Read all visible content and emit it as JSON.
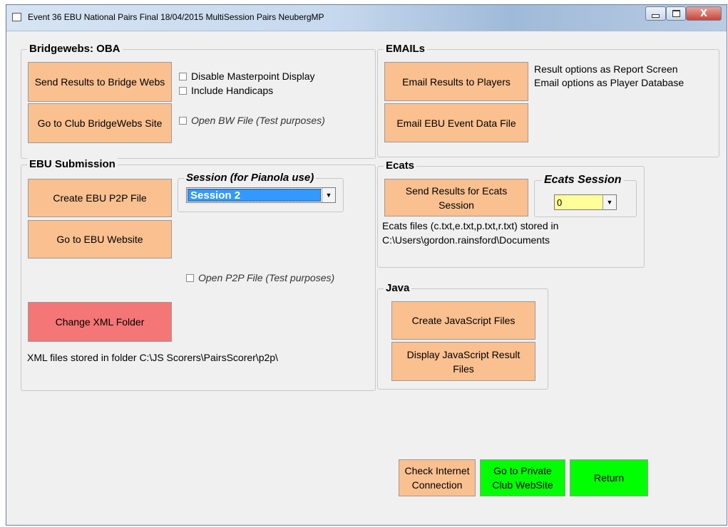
{
  "window": {
    "title": "Event 36  EBU National Pairs Final 18/04/2015 MultiSession Pairs NeubergMP",
    "controls": {
      "minimize": "–",
      "maximize": "□",
      "close": "X"
    }
  },
  "bridgewebs": {
    "legend": "Bridgewebs: OBA",
    "send_results": "Send Results to Bridge Webs",
    "go_to_club": "Go to Club BridgeWebs Site",
    "disable_masterpoint": "Disable Masterpoint Display",
    "include_handicaps": "Include Handicaps",
    "open_bw_file": "Open BW File (Test purposes)"
  },
  "emails": {
    "legend": "EMAILs",
    "email_results": "Email Results to Players",
    "email_ebu": "Email EBU Event Data File",
    "note_line1": "Result options as Report Screen",
    "note_line2": "Email options as Player Database"
  },
  "ebu": {
    "legend": "EBU Submission",
    "create_p2p": "Create EBU P2P File",
    "go_to_website": "Go to EBU Website",
    "session_legend": "Session (for Pianola use)",
    "session_value": "Session 2",
    "open_p2p_file": "Open P2P File (Test purposes)",
    "change_xml": "Change XML Folder",
    "xml_note": "XML files stored in folder C:\\JS Scorers\\PairsScorer\\p2p\\"
  },
  "ecats": {
    "legend": "Ecats",
    "send_results": "Send Results for Ecats Session",
    "session_legend": "Ecats Session",
    "session_value": "0",
    "files_line1": "Ecats files (c.txt,e.txt,p.txt,r.txt) stored in",
    "files_line2": "C:\\Users\\gordon.rainsford\\Documents"
  },
  "java": {
    "legend": "Java",
    "create_js": "Create JavaScript Files",
    "display_js": "Display JavaScript Result Files"
  },
  "bottom": {
    "check_internet": "Check Internet Connection",
    "go_private": "Go to Private Club WebSite",
    "return": "Return"
  },
  "colors": {
    "orange_button": "#fac090",
    "red_button": "#f47676",
    "green_button": "#00ff00",
    "selected_blue": "#3399ff",
    "combo_yellow": "#ffff99"
  }
}
